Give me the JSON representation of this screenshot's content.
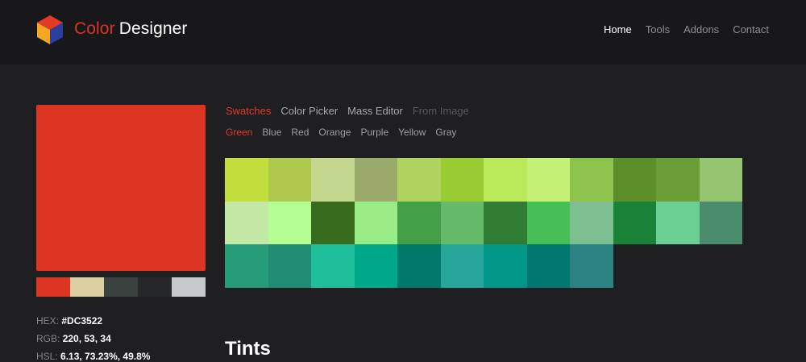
{
  "header": {
    "brand_part1": "Color",
    "brand_part2": "Designer",
    "nav": [
      {
        "label": "Home",
        "active": true
      },
      {
        "label": "Tools",
        "active": false
      },
      {
        "label": "Addons",
        "active": false
      },
      {
        "label": "Contact",
        "active": false
      }
    ]
  },
  "selected": {
    "color": "#DC3522",
    "palette": [
      "#DC3522",
      "#DCCFA2",
      "#3A4240",
      "#262728",
      "#C5C9CC"
    ],
    "hex_label": "HEX:",
    "hex_value": "#DC3522",
    "rgb_label": "RGB:",
    "rgb_value": "220, 53, 34",
    "hsl_label": "HSL:",
    "hsl_value": "6.13, 73.23%, 49.8%"
  },
  "tabs": [
    {
      "label": "Swatches",
      "state": "active"
    },
    {
      "label": "Color Picker",
      "state": "normal"
    },
    {
      "label": "Mass Editor",
      "state": "normal"
    },
    {
      "label": "From Image",
      "state": "disabled"
    }
  ],
  "subtabs": [
    {
      "label": "Green",
      "active": true
    },
    {
      "label": "Blue",
      "active": false
    },
    {
      "label": "Red",
      "active": false
    },
    {
      "label": "Orange",
      "active": false
    },
    {
      "label": "Purple",
      "active": false
    },
    {
      "label": "Yellow",
      "active": false
    },
    {
      "label": "Gray",
      "active": false
    }
  ],
  "swatches": [
    "#C3DE3D",
    "#AEC94D",
    "#C3D88E",
    "#9AAA6A",
    "#AFD35E",
    "#99CB33",
    "#BAE95A",
    "#C3F277",
    "#8BC34D",
    "#5A8F2A",
    "#6A9F38",
    "#96C572",
    "#C4E9A6",
    "#B3FF91",
    "#376B1E",
    "#98EB85",
    "#43A047",
    "#66BB6A",
    "#2E7D32",
    "#47BF55",
    "#7DBF90",
    "#188337",
    "#6BCF92",
    "#4A8C6C",
    "#269C79",
    "#228B73",
    "#1FBF9C",
    "#00A88A",
    "#00796B",
    "#26A69A",
    "#009688",
    "#00776F",
    "#2A8282"
  ],
  "section_title": "Tints",
  "icons": {
    "logo": "cube-logo-icon"
  }
}
